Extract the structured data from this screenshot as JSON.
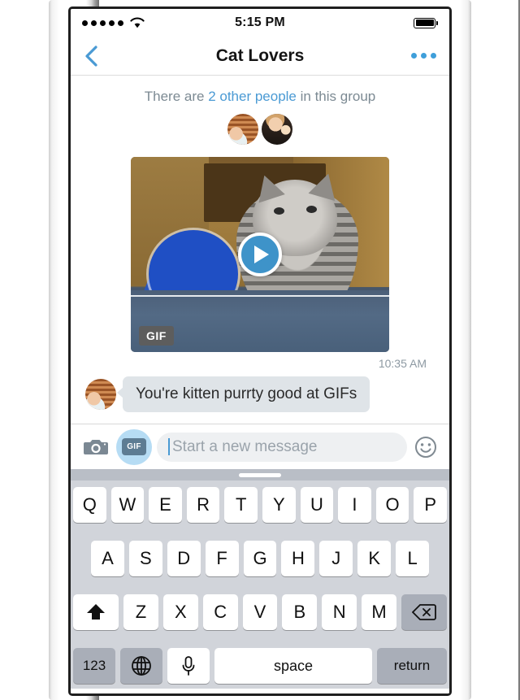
{
  "device": {
    "frame": "iphone-white",
    "buttons": [
      "silent-switch",
      "volume-up",
      "volume-down",
      "power"
    ]
  },
  "status_bar": {
    "signal_dots": 5,
    "carrier_icon": "wifi-icon",
    "time": "5:15 PM",
    "battery_icon": "battery-full-icon"
  },
  "nav_bar": {
    "back_icon": "chevron-left-icon",
    "title": "Cat Lovers",
    "more_icon": "more-horizontal-icon",
    "accent_color": "#3f9fda"
  },
  "conversation": {
    "group_notice": {
      "prefix": "There are ",
      "highlight": "2 other people",
      "suffix": " in this group",
      "highlight_color": "#4a9ad4"
    },
    "avatars": [
      {
        "name": "avatar-person-blinds",
        "alt": "person in front of wooden blinds"
      },
      {
        "name": "avatar-person-dark",
        "alt": "person on dark background"
      }
    ],
    "gif_message": {
      "badge": "GIF",
      "play_icon": "play-circle-icon",
      "alt": "gray tabby cat sitting at ping pong table with blue paddle",
      "timestamp": "10:35 AM"
    },
    "text_message": {
      "avatar_name": "avatar-person-blinds",
      "text": "You're kitten purrty good at GIFs",
      "bubble_color": "#dfe4e8"
    }
  },
  "input_bar": {
    "camera_icon": "camera-icon",
    "gif_button_label": "GIF",
    "gif_button_highlight_color": "#b6dcf4",
    "placeholder": "Start a new message",
    "value": "",
    "emoji_icon": "smiley-icon"
  },
  "keyboard": {
    "handle": "keyboard-drag-handle",
    "row1": [
      "Q",
      "W",
      "E",
      "R",
      "T",
      "Y",
      "U",
      "I",
      "O",
      "P"
    ],
    "row2": [
      "A",
      "S",
      "D",
      "F",
      "G",
      "H",
      "J",
      "K",
      "L"
    ],
    "row3_shift_icon": "shift-arrow-icon",
    "row3": [
      "Z",
      "X",
      "C",
      "V",
      "B",
      "N",
      "M"
    ],
    "row3_backspace_icon": "backspace-icon",
    "row4": {
      "numbers": "123",
      "globe_icon": "globe-icon",
      "mic_icon": "microphone-icon",
      "space": "space",
      "return": "return"
    }
  }
}
